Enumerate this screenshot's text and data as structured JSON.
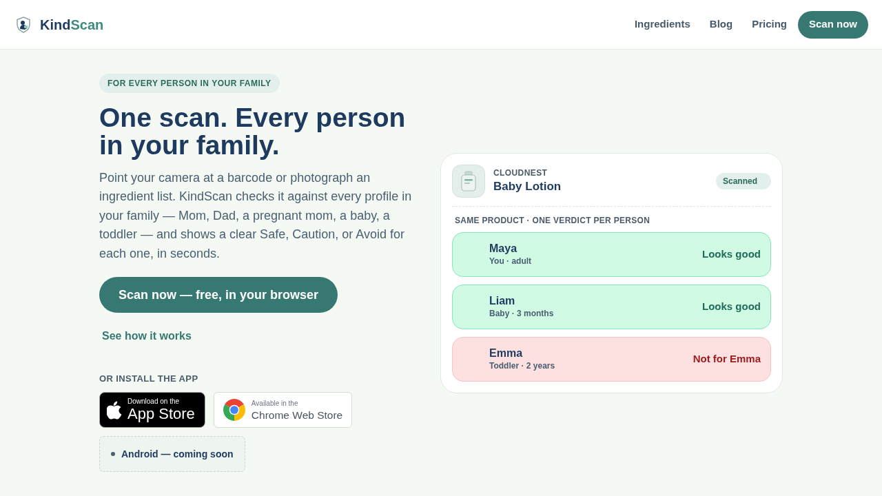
{
  "header": {
    "logo": {
      "name_start": "Kind",
      "name_end": "Scan"
    },
    "nav": [
      {
        "label": "Ingredients"
      },
      {
        "label": "Blog"
      },
      {
        "label": "Pricing"
      }
    ],
    "cta": "Scan now"
  },
  "hero": {
    "eyebrow": "FOR EVERY PERSON IN YOUR FAMILY",
    "title": "One scan. Every person in your family.",
    "description": "Point your camera at a barcode or photograph an ingredient list. KindScan checks it against every profile in your family — Mom, Dad, a pregnant mom, a baby, a toddler — and shows a clear Safe, Caution, or Avoid for each one, in seconds.",
    "primary_button": "Scan now — free, in your browser",
    "secondary_link": "See how it works",
    "install_heading": "OR INSTALL THE APP",
    "stores": [
      {
        "kind": "apple",
        "caption": "Download on the",
        "name": "App Store"
      },
      {
        "kind": "chrome",
        "caption": "Available in the",
        "name": "Chrome Web Store"
      }
    ],
    "android_note": "Android — coming soon"
  },
  "scan_card": {
    "brand": "CLOUDNEST",
    "product": "Baby Lotion",
    "status": "Scanned",
    "caption": "SAME PRODUCT · ONE VERDICT PER PERSON",
    "verdicts": [
      {
        "kind": "safe",
        "name": "Maya",
        "detail": "You · adult",
        "verdict": "Looks good"
      },
      {
        "kind": "safe",
        "name": "Liam",
        "detail": "Baby · 3 months",
        "verdict": "Looks good"
      },
      {
        "kind": "avoid",
        "name": "Emma",
        "detail": "Toddler · 2 years",
        "verdict": "Not for Emma"
      }
    ]
  }
}
